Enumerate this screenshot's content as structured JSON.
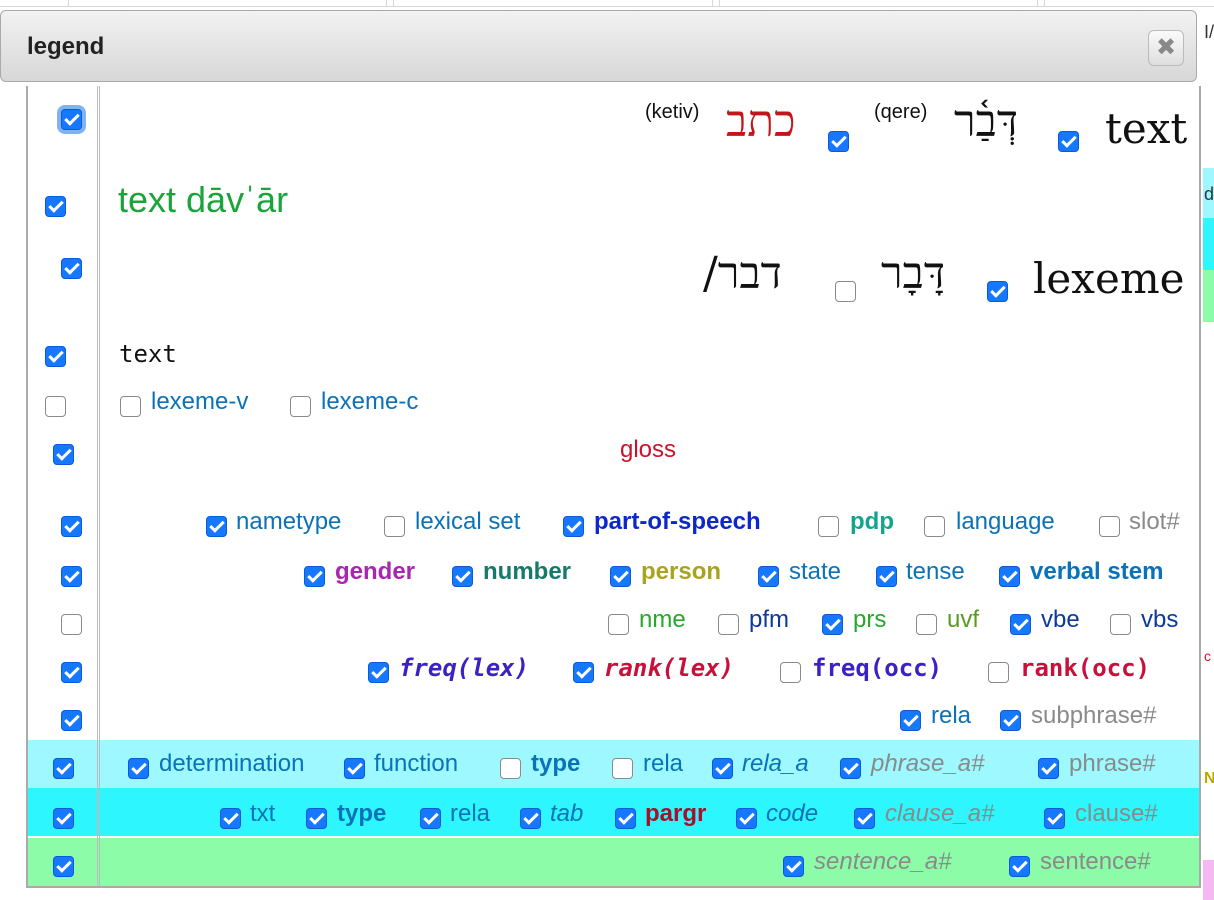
{
  "dialog": {
    "title": "legend",
    "close_label": "✖"
  },
  "row_text": {
    "ketiv_label": "(ketiv)",
    "ketiv_hebrew": "כתב",
    "qere_label": "(qere)",
    "qere_hebrew": "דְּבַ֫ר",
    "label": "text"
  },
  "row_translit": {
    "text": "text dāvˈār"
  },
  "row_lexeme": {
    "hebrew_lex": "דָּבָר",
    "hebrew_cons": "דבר/",
    "label": "lexeme"
  },
  "row_mono": {
    "text": "text"
  },
  "row_lexcodes": {
    "lexeme_v": "lexeme-v",
    "lexeme_c": "lexeme-c"
  },
  "row_gloss": {
    "text": "gloss"
  },
  "features_row1": [
    "nametype",
    "lexical set",
    "part-of-speech",
    "pdp",
    "language",
    "slot#"
  ],
  "features_row2": [
    "gender",
    "number",
    "person",
    "state",
    "tense",
    "verbal stem"
  ],
  "features_row3": [
    "nme",
    "pfm",
    "prs",
    "uvf",
    "vbe",
    "vbs"
  ],
  "features_row4": [
    "freq(lex)",
    "rank(lex)",
    "freq(occ)",
    "rank(occ)"
  ],
  "features_row5": [
    "rela",
    "subphrase#"
  ],
  "phrase_row": [
    "determination",
    "function",
    "type",
    "rela",
    "rela_a",
    "phrase_a#",
    "phrase#"
  ],
  "clause_row": [
    "txt",
    "type",
    "rela",
    "tab",
    "pargr",
    "code",
    "clause_a#",
    "clause#"
  ],
  "sentence_row": [
    "sentence_a#",
    "sentence#"
  ],
  "colors": {
    "checkbox": "#1677ff",
    "phrase_band": "#9ef8ff",
    "clause_band": "#2df6ff",
    "sentence_band": "#8cfca8",
    "ketiv_red": "#c4151c",
    "translit_green": "#1aa43c",
    "gloss_red": "#d0102a",
    "link_blue": "#0a72b8"
  }
}
